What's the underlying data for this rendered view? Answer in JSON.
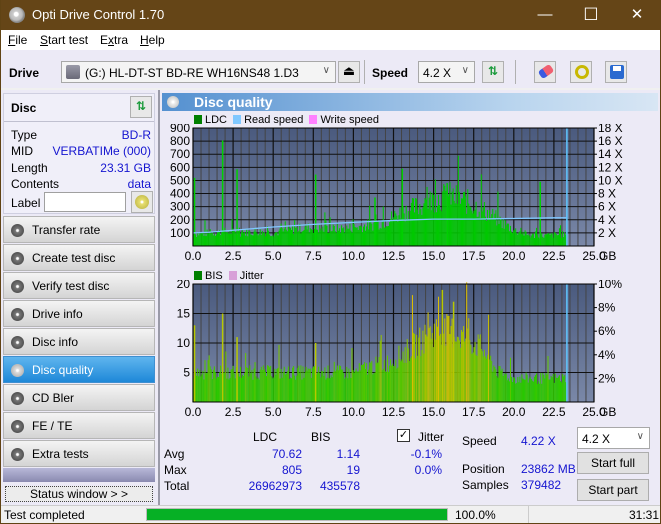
{
  "window": {
    "title": "Opti Drive Control 1.70",
    "minimize": "—",
    "maximize": "☐",
    "close": "✕"
  },
  "menu": [
    {
      "key": "F",
      "rest": "ile"
    },
    {
      "key": "S",
      "rest": "tart test"
    },
    {
      "key": "E",
      "rest": "xtra",
      "pre": ""
    },
    {
      "key": "H",
      "rest": "elp"
    }
  ],
  "toolbar": {
    "drive_label": "Drive",
    "drive_value": "(G:)  HL-DT-ST BD-RE  WH16NS48 1.D3",
    "speed_label": "Speed",
    "speed_value": "4.2 X"
  },
  "disc": {
    "title": "Disc",
    "type_label": "Type",
    "type_value": "BD-R",
    "mid_label": "MID",
    "mid_value": "VERBATIMe (000)",
    "length_label": "Length",
    "length_value": "23.31 GB",
    "contents_label": "Contents",
    "contents_value": "data",
    "label_label": "Label",
    "label_value": ""
  },
  "nav": [
    {
      "label": "Transfer rate",
      "active": false
    },
    {
      "label": "Create test disc",
      "active": false
    },
    {
      "label": "Verify test disc",
      "active": false
    },
    {
      "label": "Drive info",
      "active": false
    },
    {
      "label": "Disc info",
      "active": false
    },
    {
      "label": "Disc quality",
      "active": true
    },
    {
      "label": "CD Bler",
      "active": false
    },
    {
      "label": "FE / TE",
      "active": false
    },
    {
      "label": "Extra tests",
      "active": false
    }
  ],
  "status_window_label": "Status window > >",
  "panel_title": "Disc quality",
  "chart_data": [
    {
      "type": "bar",
      "title": "LDC",
      "legend": [
        "LDC",
        "Read speed",
        "Write speed"
      ],
      "legend_colors": [
        "#008000",
        "#80c8ff",
        "#ff80ff"
      ],
      "xlabel": "GB",
      "xlim": [
        0,
        25
      ],
      "ylim": [
        0,
        900
      ],
      "x_ticks": [
        "0.0",
        "2.5",
        "5.0",
        "7.5",
        "10.0",
        "12.5",
        "15.0",
        "17.5",
        "20.0",
        "22.5",
        "25.0"
      ],
      "y_ticks": [
        "100",
        "200",
        "300",
        "400",
        "500",
        "600",
        "700",
        "800",
        "900"
      ],
      "y2_ticks": [
        "2 X",
        "4 X",
        "6 X",
        "8 X",
        "10 X",
        "12 X",
        "14 X",
        "16 X",
        "18 X"
      ],
      "y2lim": [
        0,
        18
      ],
      "data_end_gb": 23.31,
      "ldc_profile": [
        [
          0,
          90
        ],
        [
          1,
          100
        ],
        [
          2,
          110
        ],
        [
          3,
          100
        ],
        [
          4,
          110
        ],
        [
          5,
          100
        ],
        [
          6,
          120
        ],
        [
          7,
          140
        ],
        [
          8,
          130
        ],
        [
          9,
          130
        ],
        [
          10,
          140
        ],
        [
          11,
          160
        ],
        [
          12,
          190
        ],
        [
          13,
          260
        ],
        [
          14,
          300
        ],
        [
          15,
          360
        ],
        [
          16,
          380
        ],
        [
          17,
          340
        ],
        [
          18,
          280
        ],
        [
          19,
          200
        ],
        [
          20,
          120
        ],
        [
          21,
          80
        ],
        [
          22,
          80
        ],
        [
          23.31,
          90
        ]
      ],
      "ldc_spikes": [
        [
          0.05,
          520
        ],
        [
          1.8,
          805
        ],
        [
          2.7,
          585
        ],
        [
          7.6,
          545
        ],
        [
          11.3,
          370
        ],
        [
          13.0,
          590
        ],
        [
          15.8,
          480
        ],
        [
          21.6,
          490
        ]
      ],
      "read_speed": [
        [
          0,
          2.0
        ],
        [
          1,
          2.1
        ],
        [
          2.5,
          2.4
        ],
        [
          5,
          2.9
        ],
        [
          7.5,
          3.3
        ],
        [
          10,
          3.6
        ],
        [
          12.5,
          3.9
        ],
        [
          15,
          4.1
        ],
        [
          17.5,
          4.1
        ],
        [
          20,
          4.2
        ],
        [
          22.5,
          4.3
        ],
        [
          23.31,
          4.3
        ]
      ]
    },
    {
      "type": "bar",
      "title": "BIS",
      "legend": [
        "BIS",
        "Jitter"
      ],
      "legend_colors": [
        "#008000",
        "#d8a0d8"
      ],
      "xlabel": "GB",
      "xlim": [
        0,
        25
      ],
      "ylim": [
        0,
        20
      ],
      "x_ticks": [
        "0.0",
        "2.5",
        "5.0",
        "7.5",
        "10.0",
        "12.5",
        "15.0",
        "17.5",
        "20.0",
        "22.5",
        "25.0"
      ],
      "y_ticks": [
        "5",
        "10",
        "15",
        "20"
      ],
      "y2_ticks": [
        "2%",
        "4%",
        "6%",
        "8%",
        "10%"
      ],
      "y2lim": [
        0,
        10
      ],
      "data_end_gb": 23.31,
      "bis_profile": [
        [
          0,
          5
        ],
        [
          2,
          5
        ],
        [
          4,
          5
        ],
        [
          6,
          5
        ],
        [
          8,
          5
        ],
        [
          10,
          5
        ],
        [
          11,
          6
        ],
        [
          12,
          6.5
        ],
        [
          13,
          8
        ],
        [
          14,
          10
        ],
        [
          15,
          12
        ],
        [
          16,
          12
        ],
        [
          17,
          11
        ],
        [
          18,
          9
        ],
        [
          19,
          5
        ],
        [
          20,
          4
        ],
        [
          22,
          4
        ],
        [
          23.31,
          4
        ]
      ],
      "bis_spikes": [
        [
          0.05,
          13
        ],
        [
          1.8,
          15
        ],
        [
          2.7,
          11
        ],
        [
          7.6,
          10
        ],
        [
          15.5,
          19
        ],
        [
          16.2,
          17
        ]
      ]
    }
  ],
  "stats": {
    "col_ldc": "LDC",
    "col_bis": "BIS",
    "avg_label": "Avg",
    "avg_ldc": "70.62",
    "avg_bis": "1.14",
    "max_label": "Max",
    "max_ldc": "805",
    "max_bis": "19",
    "total_label": "Total",
    "total_ldc": "26962973",
    "total_bis": "435578",
    "jitter_label": "Jitter",
    "jitter_checked": true,
    "jitter_avg": "-0.1%",
    "jitter_max": "0.0%",
    "speed_label": "Speed",
    "speed_value": "4.22 X",
    "position_label": "Position",
    "position_value": "23862 MB",
    "samples_label": "Samples",
    "samples_value": "379482",
    "speed_select": "4.2 X",
    "start_full": "Start full",
    "start_part": "Start part"
  },
  "statusbar": {
    "text": "Test completed",
    "progress_percent": 100.0,
    "progress_text": "100.0%",
    "time": "31:31"
  }
}
